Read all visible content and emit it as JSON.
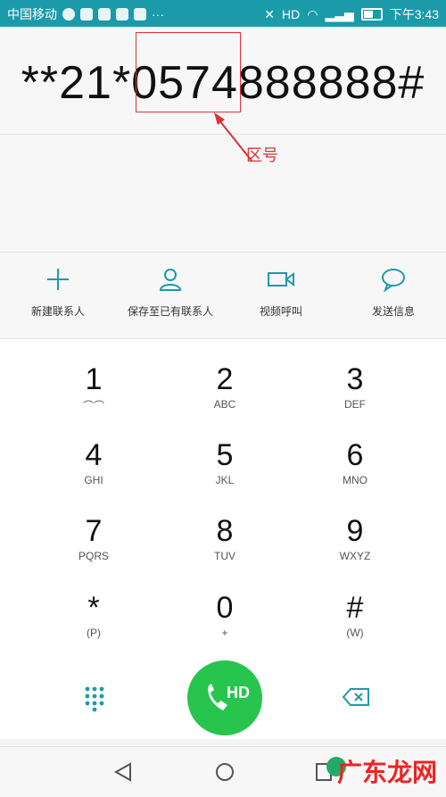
{
  "status_bar": {
    "carrier": "中国移动",
    "time": "下午3:43",
    "hd": "HD"
  },
  "dialer": {
    "number": "**21*0574888888#",
    "annotation": "区号"
  },
  "actions": [
    {
      "label": "新建联系人",
      "icon": "plus-icon"
    },
    {
      "label": "保存至已有联系人",
      "icon": "person-icon"
    },
    {
      "label": "视频呼叫",
      "icon": "video-icon"
    },
    {
      "label": "发送信息",
      "icon": "message-icon"
    }
  ],
  "keys": [
    {
      "digit": "1",
      "letters": ""
    },
    {
      "digit": "2",
      "letters": "ABC"
    },
    {
      "digit": "3",
      "letters": "DEF"
    },
    {
      "digit": "4",
      "letters": "GHI"
    },
    {
      "digit": "5",
      "letters": "JKL"
    },
    {
      "digit": "6",
      "letters": "MNO"
    },
    {
      "digit": "7",
      "letters": "PQRS"
    },
    {
      "digit": "8",
      "letters": "TUV"
    },
    {
      "digit": "9",
      "letters": "WXYZ"
    },
    {
      "digit": "*",
      "letters": "(P)"
    },
    {
      "digit": "0",
      "letters": "+"
    },
    {
      "digit": "#",
      "letters": "(W)"
    }
  ],
  "call_button": {
    "label": "HD"
  },
  "watermark": {
    "text": "广东龙网"
  }
}
